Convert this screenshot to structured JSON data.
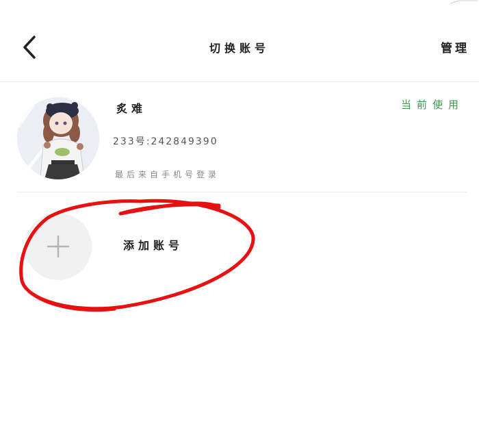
{
  "header": {
    "title": "切换账号",
    "manage_label": "管理",
    "back_icon": "chevron-left-icon"
  },
  "account": {
    "nickname": "炙难",
    "account_id": "233号:242849390",
    "login_note": "最后来自手机号登录",
    "status": "当前使用",
    "status_color": "#3f9a4a"
  },
  "add_account": {
    "label": "添加账号",
    "icon": "plus-icon"
  },
  "annotation": {
    "color": "#e81010",
    "shape": "hand-drawn-circle"
  }
}
